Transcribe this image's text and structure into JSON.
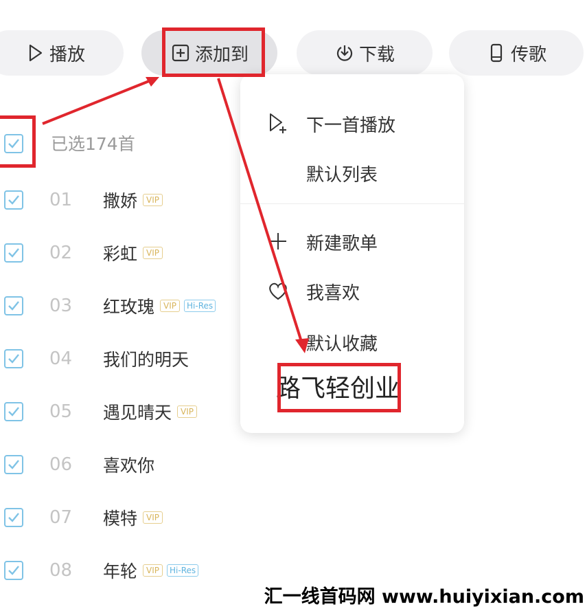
{
  "toolbar": {
    "play_label": "播放",
    "add_to_label": "添加到",
    "download_label": "下载",
    "transfer_label": "传歌"
  },
  "selection": {
    "text": "已选174首"
  },
  "songs": [
    {
      "num": "01",
      "title": "撒娇",
      "vip": "VIP",
      "hires": ""
    },
    {
      "num": "02",
      "title": "彩虹",
      "vip": "VIP",
      "hires": ""
    },
    {
      "num": "03",
      "title": "红玫瑰",
      "vip": "VIP",
      "hires": "Hi-Res"
    },
    {
      "num": "04",
      "title": "我们的明天",
      "vip": "",
      "hires": ""
    },
    {
      "num": "05",
      "title": "遇见晴天",
      "vip": "VIP",
      "hires": ""
    },
    {
      "num": "06",
      "title": "喜欢你",
      "vip": "",
      "hires": ""
    },
    {
      "num": "07",
      "title": "模特",
      "vip": "VIP",
      "hires": ""
    },
    {
      "num": "08",
      "title": "年轮",
      "vip": "VIP",
      "hires": "Hi-Res"
    }
  ],
  "menu": {
    "next_play": "下一首播放",
    "default_list": "默认列表",
    "new_playlist": "新建歌单",
    "i_like": "我喜欢",
    "default_fav": "默认收藏",
    "custom_playlist": "路飞轻创业"
  },
  "watermark": "汇一线首码网 www.huiyixian.com",
  "colors": {
    "accent_red": "#e0262d",
    "checkbox_blue": "#7fc3e6",
    "vip_gold": "#d8b45a",
    "hires_blue": "#5eb3df"
  }
}
